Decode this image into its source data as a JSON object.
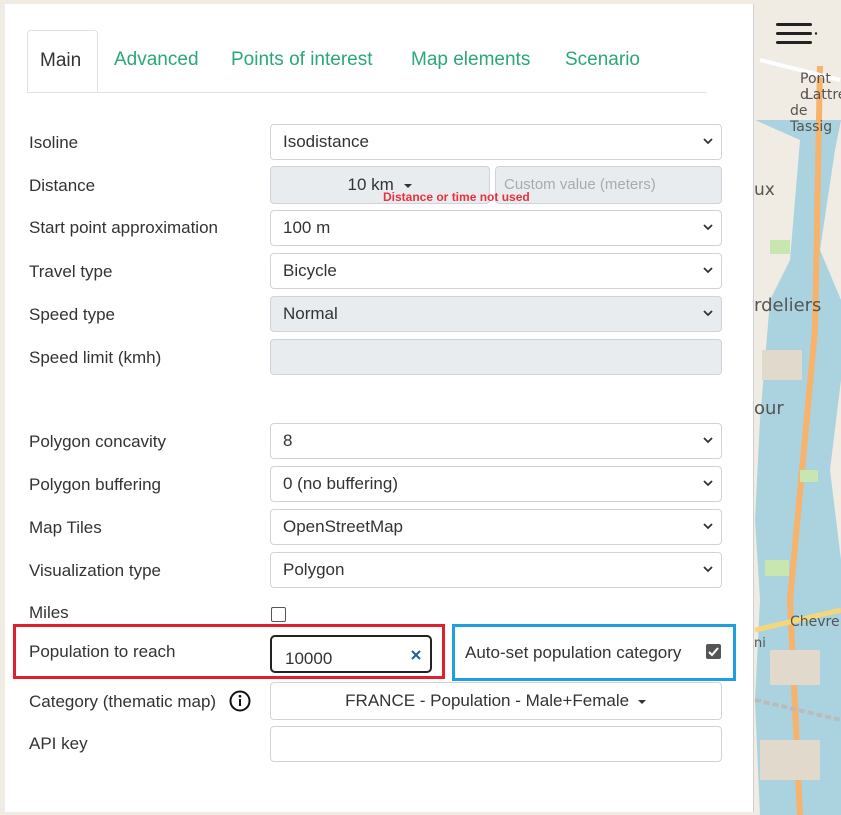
{
  "tabs": [
    {
      "label": "Main"
    },
    {
      "label": "Advanced"
    },
    {
      "label": "Points of interest"
    },
    {
      "label": "Map elements"
    },
    {
      "label": "Scenario"
    }
  ],
  "fields": {
    "isoline": {
      "label": "Isoline",
      "value": "Isodistance"
    },
    "distance": {
      "label": "Distance",
      "value": "10 km",
      "placeholder": "Custom value  (meters)",
      "warning": "Distance or time not used"
    },
    "start_point": {
      "label": "Start point approximation",
      "value": "100 m"
    },
    "travel_type": {
      "label": "Travel type",
      "value": "Bicycle"
    },
    "speed_type": {
      "label": "Speed type",
      "value": "Normal"
    },
    "speed_limit": {
      "label": "Speed limit (kmh)",
      "value": ""
    },
    "polygon_concavity": {
      "label": "Polygon concavity",
      "value": "8"
    },
    "polygon_buffering": {
      "label": "Polygon buffering",
      "value": "0 (no buffering)"
    },
    "map_tiles": {
      "label": "Map Tiles",
      "value": "OpenStreetMap"
    },
    "visualization_type": {
      "label": "Visualization type",
      "value": "Polygon"
    },
    "miles": {
      "label": "Miles",
      "checked": false
    },
    "population": {
      "label": "Population to reach",
      "value": "10000"
    },
    "auto_population": {
      "label": "Auto-set population category",
      "checked": true
    },
    "category": {
      "label": "Category (thematic map)",
      "value": "FRANCE - Population - Male+Female"
    },
    "api_key": {
      "label": "API key",
      "value": ""
    }
  },
  "map_labels": [
    "Pont d",
    "Lattre",
    "de Tassig",
    "ux",
    "rdeliers",
    "our",
    "Chevre",
    "ni"
  ],
  "colors": {
    "accent": "#2aa877",
    "highlight_red": "#e0202e",
    "highlight_blue": "#1ea0e0",
    "warning": "#e8313f"
  }
}
